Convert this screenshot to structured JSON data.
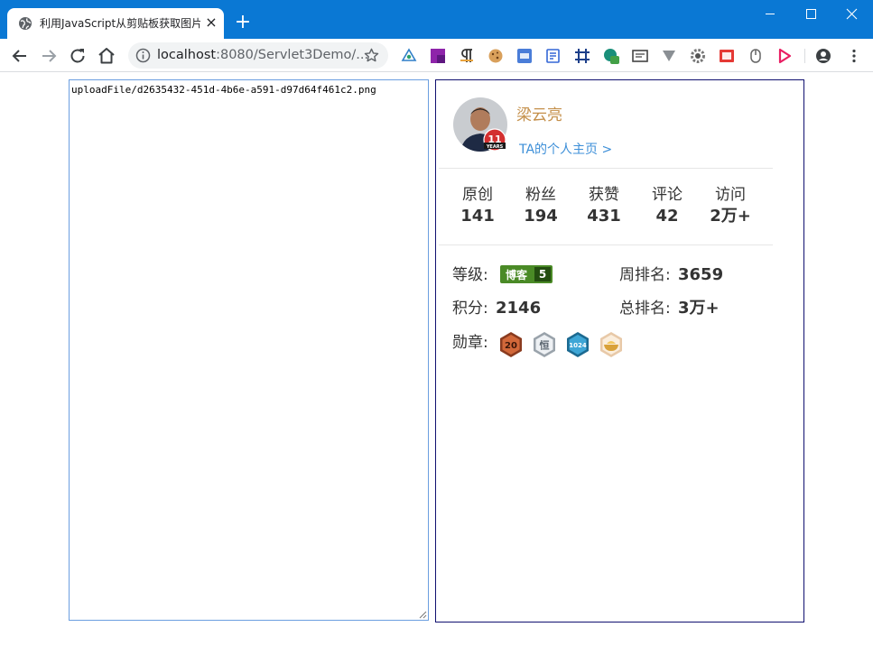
{
  "browser": {
    "tab_title": "利用JavaScript从剪贴板获取图片",
    "tab_close": "×",
    "new_tab": "+",
    "url_host": "localhost",
    "url_rest": ":8080/Servlet3Demo/..."
  },
  "textarea": {
    "value": "uploadFile/d2635432-451d-4b6e-a591-d97d64f461c2.png"
  },
  "profile": {
    "username": "梁云亮",
    "years_badge": "11",
    "years_text": "YEARS",
    "homepage_link": "TA的个人主页 >",
    "stats": [
      {
        "label": "原创",
        "value": "141"
      },
      {
        "label": "粉丝",
        "value": "194"
      },
      {
        "label": "获赞",
        "value": "431"
      },
      {
        "label": "评论",
        "value": "42"
      },
      {
        "label": "访问",
        "value": "2万+"
      }
    ],
    "level_label": "等级:",
    "level_badge_text": "博客",
    "level_badge_num": "5",
    "weekly_rank_label": "周排名:",
    "weekly_rank_value": "3659",
    "points_label": "积分:",
    "points_value": "2146",
    "total_rank_label": "总排名:",
    "total_rank_value": "3万+",
    "medals_label": "勋章:",
    "medals": [
      "20",
      "恒",
      "1024",
      ""
    ]
  },
  "colors": {
    "titlebar": "#0a78d4",
    "username": "#c48f4a",
    "link": "#3d8fd8",
    "level_badge": "#4a8a26"
  }
}
